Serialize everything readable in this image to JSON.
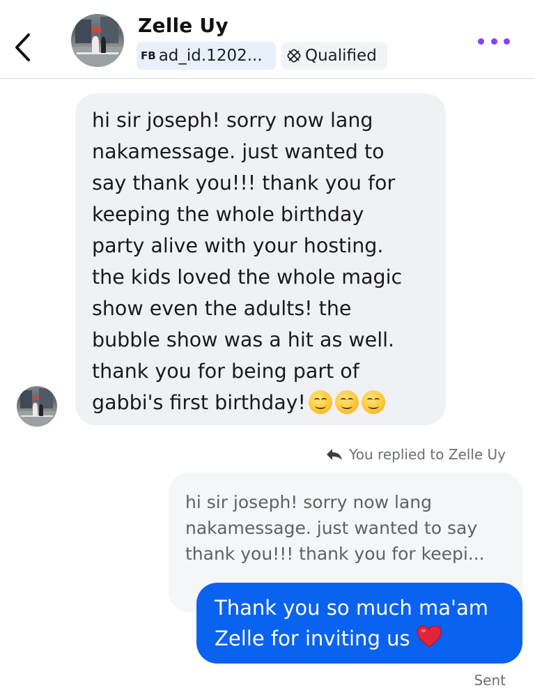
{
  "header": {
    "contact_name": "Zelle Uy",
    "ad_chip_prefix": "FB",
    "ad_chip_text": "ad_id.1202...",
    "status_chip_text": "Qualified",
    "accent_color": "#8a3ffc"
  },
  "messages": {
    "incoming": {
      "text": "hi sir joseph! sorry now lang\nnakamessage. just wanted to\nsay thank you!!! thank you for\nkeeping the whole birthday\nparty alive with your hosting.\nthe kids loved the whole magic\nshow even the adults! the\nbubble show was a hit as well.\nthank you for being part of\ngabbi's first birthday!",
      "emoji_icons": [
        "smiling-face-icon",
        "smiling-face-icon",
        "smiling-face-icon"
      ]
    },
    "reply_label": "You replied to Zelle Uy",
    "quoted_text": "hi sir joseph! sorry now lang\nnakamessage. just wanted to say\nthank you!!! thank you for keepi...",
    "outgoing": {
      "text": "Thank you so much ma'am\nZelle for inviting us",
      "emoji_icon": "red-heart-icon",
      "bubble_color": "#0a62f0"
    },
    "status": "Sent"
  }
}
